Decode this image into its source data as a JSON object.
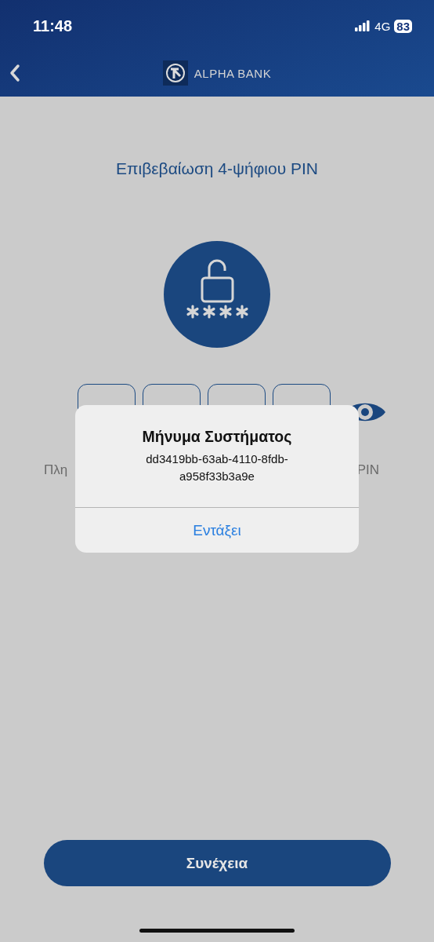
{
  "status_bar": {
    "time": "11:48",
    "network": "4G",
    "battery": "83"
  },
  "nav": {
    "brand": "ALPHA BANK"
  },
  "title": "Επιβεβαίωση 4-ψήφιου PIN",
  "pin_boxes": [
    {
      "filled": false
    },
    {
      "filled": false
    },
    {
      "filled": false
    },
    {
      "filled": false
    }
  ],
  "hint": {
    "left_visible": "Πλη",
    "right_visible": "PIN"
  },
  "dialog": {
    "title": "Μήνυμα Συστήματος",
    "message": "dd3419bb-63ab-4110-8fdb-a958f33b3a9e",
    "button": "Εντάξει"
  },
  "continue_button": "Συνέχεια"
}
